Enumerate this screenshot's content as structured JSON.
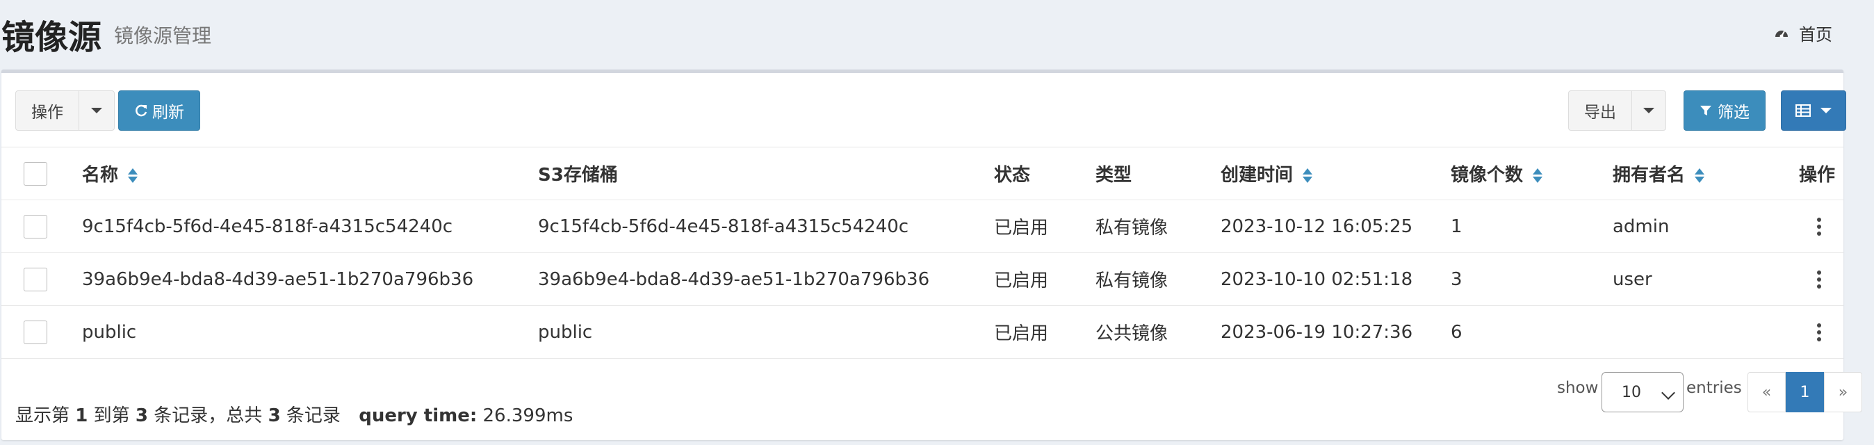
{
  "header": {
    "title": "镜像源",
    "subtitle": "镜像源管理",
    "home_label": "首页"
  },
  "toolbar": {
    "action_label": "操作",
    "refresh_label": "刷新",
    "export_label": "导出",
    "filter_label": "筛选"
  },
  "table": {
    "columns": [
      "名称",
      "S3存储桶",
      "状态",
      "类型",
      "创建时间",
      "镜像个数",
      "拥有者名",
      "操作"
    ],
    "rows": [
      {
        "name": "9c15f4cb-5f6d-4e45-818f-a4315c54240c",
        "bucket": "9c15f4cb-5f6d-4e45-818f-a4315c54240c",
        "status": "已启用",
        "type": "私有镜像",
        "created": "2023-10-12 16:05:25",
        "count": "1",
        "owner": "admin"
      },
      {
        "name": "39a6b9e4-bda8-4d39-ae51-1b270a796b36",
        "bucket": "39a6b9e4-bda8-4d39-ae51-1b270a796b36",
        "status": "已启用",
        "type": "私有镜像",
        "created": "2023-10-10 02:51:18",
        "count": "3",
        "owner": "user"
      },
      {
        "name": "public",
        "bucket": "public",
        "status": "已启用",
        "type": "公共镜像",
        "created": "2023-06-19 10:27:36",
        "count": "6",
        "owner": ""
      }
    ]
  },
  "footer": {
    "info_prefix": "显示第",
    "info_from": "1",
    "info_mid1": "到第",
    "info_to": "3",
    "info_mid2": "条记录，总共",
    "info_total": "3",
    "info_suffix": "条记录",
    "query_label": "query time:",
    "query_value": "26.399ms",
    "show_label": "show",
    "page_size": "10",
    "entries_label": "entries",
    "prev": "«",
    "current_page": "1",
    "next": "»"
  },
  "colors": {
    "primary": "#3c8dbc",
    "navy": "#337ab7",
    "background": "#ecf0f5"
  }
}
